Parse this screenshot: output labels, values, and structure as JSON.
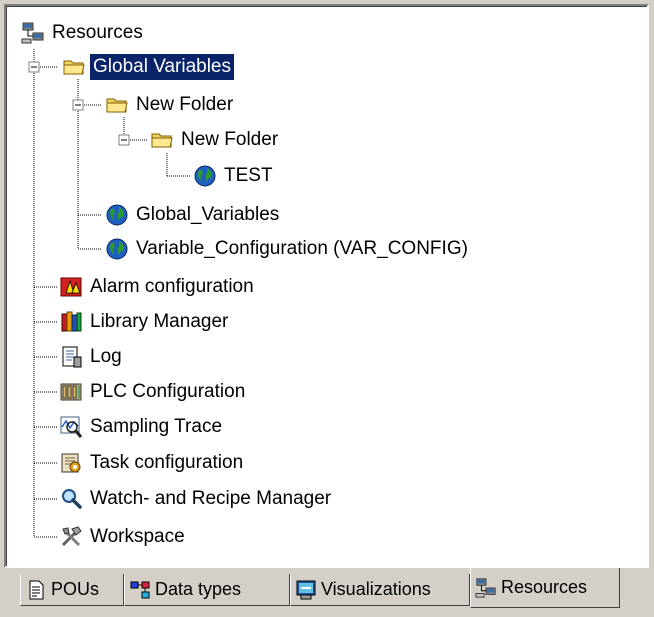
{
  "tree": {
    "root": {
      "label": "Resources",
      "icon": "resources-icon"
    },
    "items": [
      {
        "label": "Global Variables",
        "icon": "folder-icon",
        "selected": true
      },
      {
        "label": "New Folder",
        "icon": "folder-icon"
      },
      {
        "label": "New Folder",
        "icon": "folder-icon"
      },
      {
        "label": "TEST",
        "icon": "globe-icon"
      },
      {
        "label": "Global_Variables",
        "icon": "globe-icon"
      },
      {
        "label": "Variable_Configuration (VAR_CONFIG)",
        "icon": "globe-icon"
      },
      {
        "label": "Alarm configuration",
        "icon": "alarm-icon"
      },
      {
        "label": "Library Manager",
        "icon": "library-icon"
      },
      {
        "label": "Log",
        "icon": "log-icon"
      },
      {
        "label": "PLC Configuration",
        "icon": "plc-config-icon"
      },
      {
        "label": "Sampling Trace",
        "icon": "sampling-trace-icon"
      },
      {
        "label": "Task configuration",
        "icon": "task-config-icon"
      },
      {
        "label": "Watch- and Recipe Manager",
        "icon": "magnifier-icon"
      },
      {
        "label": "Workspace",
        "icon": "workspace-tools-icon"
      }
    ]
  },
  "tabs": [
    {
      "label": "POUs",
      "icon": "document-icon"
    },
    {
      "label": "Data types",
      "icon": "data-types-icon"
    },
    {
      "label": "Visualizations",
      "icon": "visualization-icon"
    },
    {
      "label": "Resources",
      "icon": "resources-icon",
      "active": true
    }
  ],
  "colors": {
    "selection": "#0a246a",
    "face": "#d4d0c8"
  }
}
